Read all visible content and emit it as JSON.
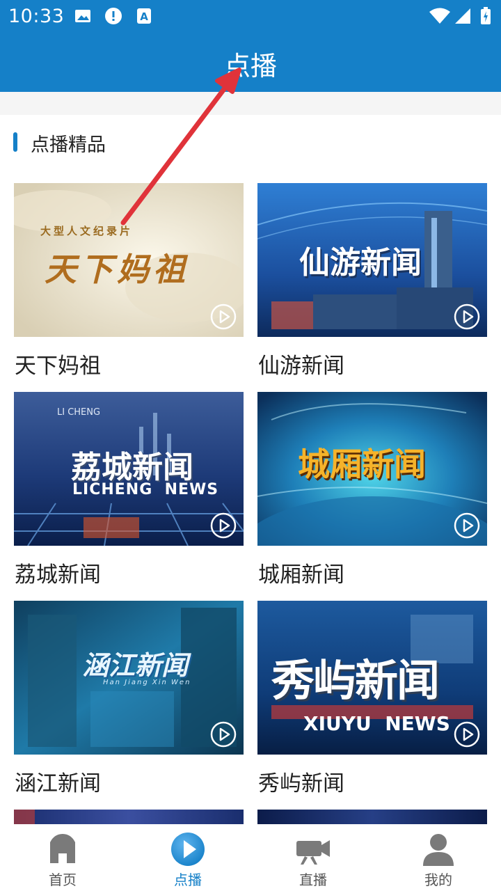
{
  "status_bar": {
    "time": "10:33",
    "icons": [
      "image-icon",
      "alert-icon",
      "a-badge-icon",
      "wifi-icon",
      "signal-icon",
      "battery-icon"
    ]
  },
  "app_bar": {
    "title": "点播"
  },
  "section": {
    "title": "点播精品"
  },
  "tiles": [
    {
      "label": "天下妈祖",
      "thumb_caption_small": "大型人文纪录片",
      "thumb_caption": "天下妈祖"
    },
    {
      "label": "仙游新闻",
      "thumb_caption": "仙游新闻"
    },
    {
      "label": "荔城新闻",
      "thumb_caption": "荔城新闻",
      "thumb_caption_en": "LICHENG  NEWS",
      "thumb_caption_small": "LI CHENG"
    },
    {
      "label": "城厢新闻",
      "thumb_caption": "城厢新闻"
    },
    {
      "label": "涵江新闻",
      "thumb_caption": "涵江新闻",
      "thumb_caption_small": "Han Jiang Xin Wen"
    },
    {
      "label": "秀屿新闻",
      "thumb_caption": "秀屿新闻",
      "thumb_caption_en": "XIUYU  NEWS"
    }
  ],
  "bottom_nav": [
    {
      "label": "首页",
      "icon": "home-icon",
      "active": false
    },
    {
      "label": "点播",
      "icon": "play-circle-icon",
      "active": true
    },
    {
      "label": "直播",
      "icon": "video-camera-icon",
      "active": false
    },
    {
      "label": "我的",
      "icon": "person-icon",
      "active": false
    }
  ],
  "colors": {
    "primary": "#1580c8",
    "annotation_arrow": "#e0333a"
  }
}
